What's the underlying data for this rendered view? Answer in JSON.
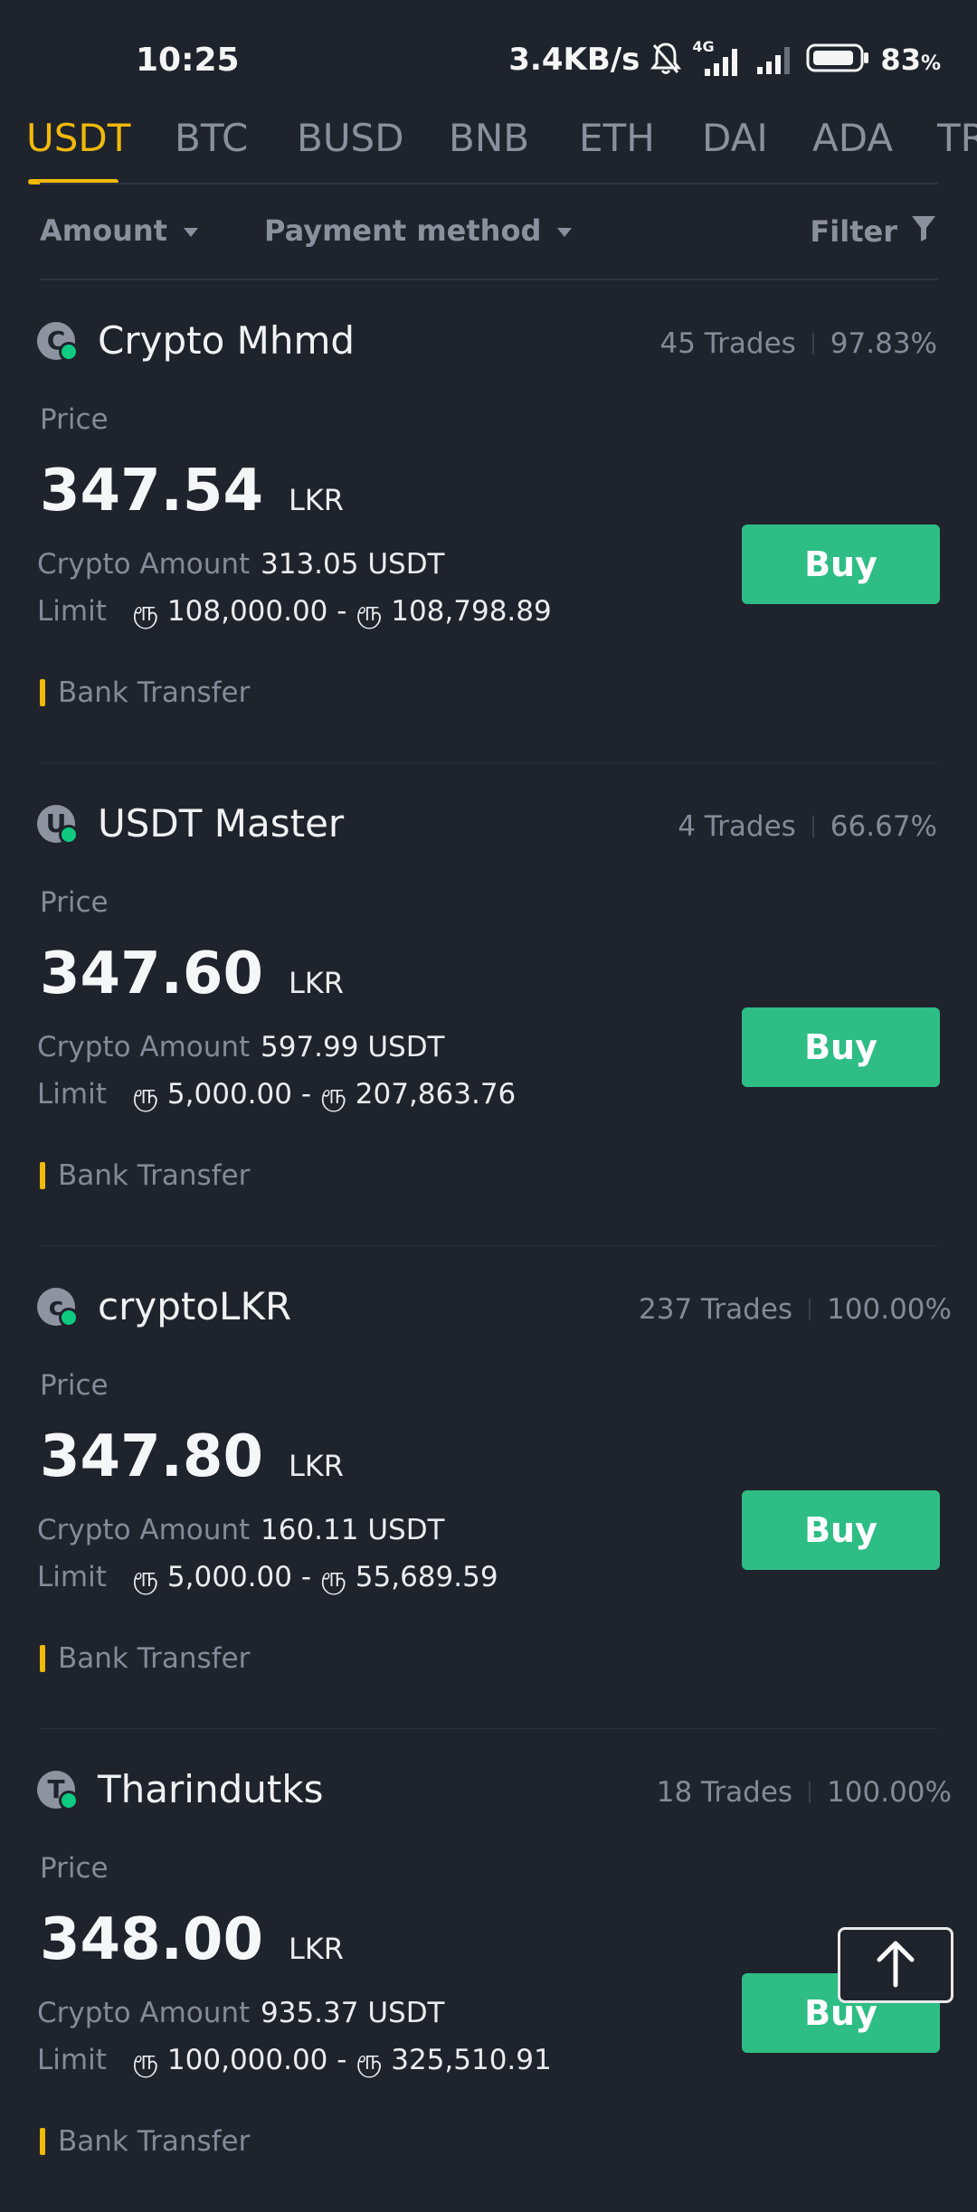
{
  "status_bar": {
    "time": "10:25",
    "net_speed": "3.4KB/s",
    "network_type": "4G",
    "battery_percent": "83",
    "battery_suffix": "%"
  },
  "tabs": [
    {
      "label": "USDT",
      "active": true
    },
    {
      "label": "BTC",
      "active": false
    },
    {
      "label": "BUSD",
      "active": false
    },
    {
      "label": "BNB",
      "active": false
    },
    {
      "label": "ETH",
      "active": false
    },
    {
      "label": "DAI",
      "active": false
    },
    {
      "label": "ADA",
      "active": false
    },
    {
      "label": "TR",
      "active": false
    }
  ],
  "filters": {
    "amount_label": "Amount",
    "payment_label": "Payment method",
    "filter_label": "Filter"
  },
  "labels": {
    "price": "Price",
    "crypto_amount": "Crypto Amount",
    "limit": "Limit",
    "buy": "Buy"
  },
  "offers": [
    {
      "avatar_letter": "C",
      "name": "Crypto Mhmd",
      "trades": "45 Trades",
      "completion": "97.83%",
      "price": "347.54",
      "currency": "LKR",
      "crypto_amount": "313.05 USDT",
      "limit": "ரூ 108,000.00 - ரூ 108,798.89",
      "payment_method": "Bank Transfer"
    },
    {
      "avatar_letter": "U",
      "name": "USDT Master",
      "trades": "4 Trades",
      "completion": "66.67%",
      "price": "347.60",
      "currency": "LKR",
      "crypto_amount": "597.99 USDT",
      "limit": "ரூ 5,000.00 - ரூ 207,863.76",
      "payment_method": "Bank Transfer"
    },
    {
      "avatar_letter": "c",
      "name": "cryptoLKR",
      "trades": "237 Trades",
      "completion": "100.00%",
      "price": "347.80",
      "currency": "LKR",
      "crypto_amount": "160.11 USDT",
      "limit": "ரூ 5,000.00 - ரூ 55,689.59",
      "payment_method": "Bank Transfer"
    },
    {
      "avatar_letter": "T",
      "name": "Tharindutks",
      "trades": "18 Trades",
      "completion": "100.00%",
      "price": "348.00",
      "currency": "LKR",
      "crypto_amount": "935.37 USDT",
      "limit": "ரூ 100,000.00 - ரூ 325,510.91",
      "payment_method": "Bank Transfer"
    }
  ],
  "colors": {
    "background": "#1f232c",
    "accent": "#f0b90b",
    "buy": "#2ebd85",
    "online": "#0ecb81",
    "muted_text": "#848a96"
  },
  "icons": {
    "status": [
      "bell-muted-icon",
      "signal-icon",
      "battery-icon"
    ],
    "filter": "funnel-icon",
    "scroll_top": "arrow-up-icon"
  }
}
